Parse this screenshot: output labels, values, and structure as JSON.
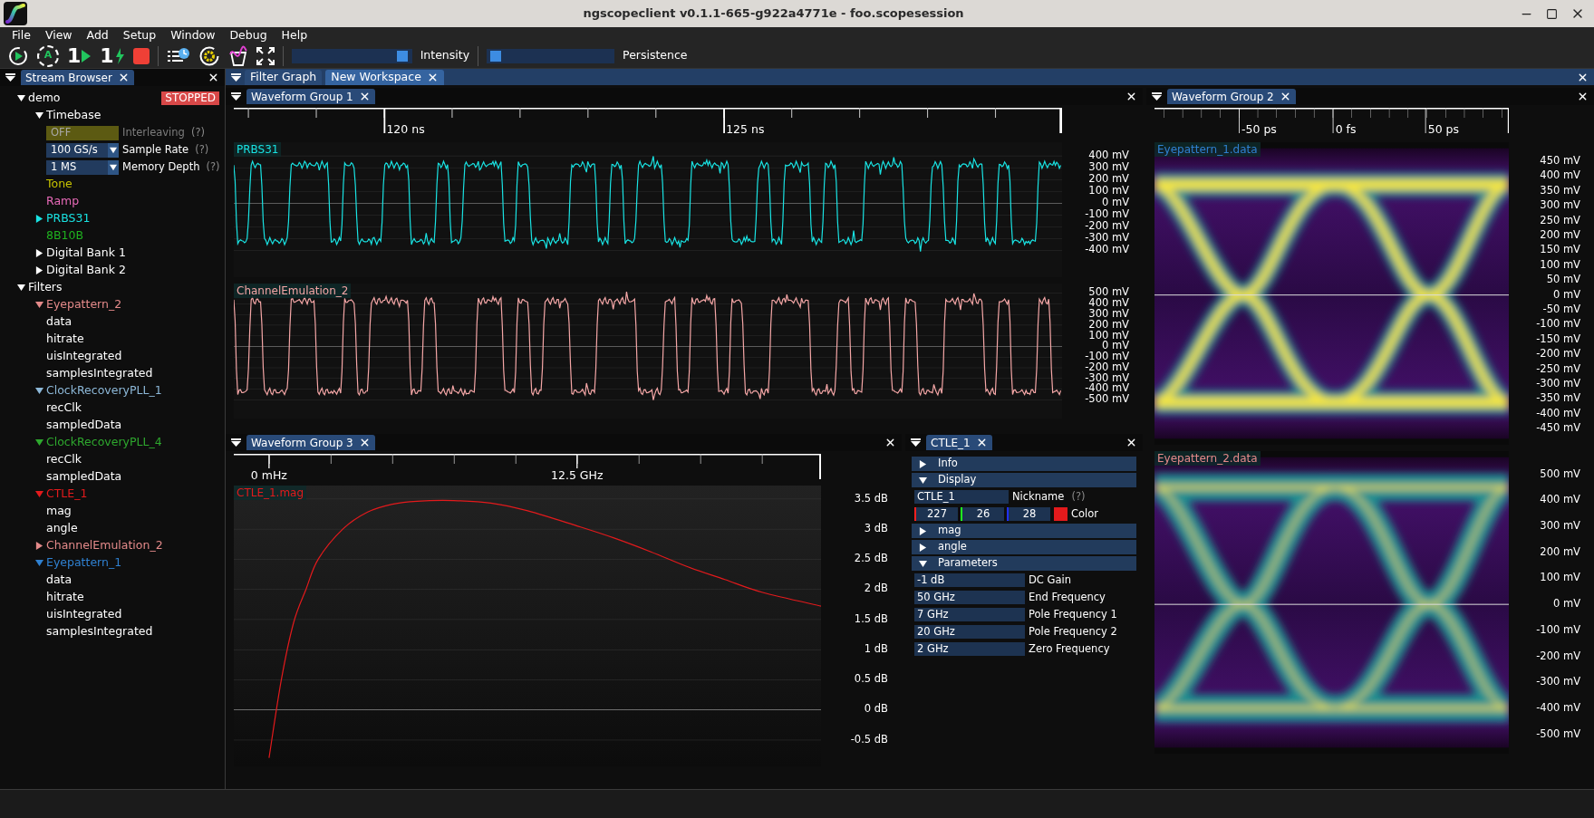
{
  "window": {
    "title": "ngscopeclient v0.1.1-665-g922a4771e  - foo.scopesession"
  },
  "menu": [
    "File",
    "View",
    "Add",
    "Setup",
    "Window",
    "Debug",
    "Help"
  ],
  "toolbar": {
    "buttons": [
      {
        "kind": "start"
      },
      {
        "kind": "auto",
        "glyph": "A"
      },
      {
        "kind": "single",
        "glyph": "1"
      },
      {
        "kind": "force",
        "glyph": "1"
      },
      {
        "kind": "stop"
      },
      {
        "kind": "history"
      },
      {
        "kind": "settings"
      },
      {
        "kind": "filter"
      },
      {
        "kind": "fullscreen"
      }
    ],
    "sliders": [
      {
        "label": "Intensity",
        "level": 0.97
      },
      {
        "label": "Persistence",
        "level": 0.02
      }
    ]
  },
  "stream_browser": {
    "tab": "Stream Browser",
    "tree": [
      {
        "label": "demo",
        "expanded": true,
        "badge": "STOPPED",
        "children": [
          {
            "label": "Timebase",
            "expanded": true,
            "children": [
              {
                "kind": "toggle",
                "value": "OFF",
                "label": "Interleaving",
                "help": "(?)",
                "disabled": true
              },
              {
                "kind": "select",
                "value": "100 GS/s",
                "label": "Sample Rate",
                "help": "(?)",
                "disabled": false
              },
              {
                "kind": "select",
                "value": "1 MS",
                "label": "Memory Depth",
                "help": "(?)",
                "disabled": false
              }
            ]
          },
          {
            "label": "Tone",
            "color": "#c8c400"
          },
          {
            "label": "Ramp",
            "color": "#e86ab8"
          },
          {
            "label": "PRBS31",
            "color": "#19e3e3",
            "expanded": false
          },
          {
            "label": "8B10B",
            "color": "#1fb21f"
          },
          {
            "label": "Digital Bank 1",
            "expanded": false
          },
          {
            "label": "Digital Bank 2",
            "expanded": false
          }
        ]
      },
      {
        "label": "Filters",
        "expanded": true,
        "children": [
          {
            "label": "Eyepattern_2",
            "color": "#e48a8a",
            "expanded": true,
            "children": [
              {
                "label": "data"
              },
              {
                "label": "hitrate"
              },
              {
                "label": "uisIntegrated"
              },
              {
                "label": "samplesIntegrated"
              }
            ]
          },
          {
            "label": "ClockRecoveryPLL_1",
            "color": "#8db8d8",
            "expanded": true,
            "children": [
              {
                "label": "recClk"
              },
              {
                "label": "sampledData"
              }
            ]
          },
          {
            "label": "ClockRecoveryPLL_4",
            "color": "#2ea82e",
            "expanded": true,
            "children": [
              {
                "label": "recClk"
              },
              {
                "label": "sampledData"
              }
            ]
          },
          {
            "label": "CTLE_1",
            "color": "#e31a1c",
            "expanded": true,
            "children": [
              {
                "label": "mag"
              },
              {
                "label": "angle"
              }
            ]
          },
          {
            "label": "ChannelEmulation_2",
            "color": "#e48a8a",
            "expanded": false
          },
          {
            "label": "Eyepattern_1",
            "color": "#2f80d0",
            "expanded": true,
            "children": [
              {
                "label": "data"
              },
              {
                "label": "hitrate"
              },
              {
                "label": "uisIntegrated"
              },
              {
                "label": "samplesIntegrated"
              }
            ]
          }
        ]
      }
    ]
  },
  "workspace_tabs": [
    {
      "label": "Filter Graph",
      "selected": false,
      "closable": false
    },
    {
      "label": "New Workspace",
      "selected": true,
      "closable": true
    }
  ],
  "waveform_groups": [
    {
      "title": "Waveform Group 1",
      "time_labels": [
        "120 ns",
        "125 ns"
      ],
      "plots": [
        {
          "name": "PRBS31",
          "kind": "trace",
          "color": "#19e3e3",
          "y_labels": [
            "400 mV",
            "300 mV",
            "200 mV",
            "100 mV",
            "0 mV",
            "-100 mV",
            "-200 mV",
            "-300 mV",
            "-400 mV"
          ]
        },
        {
          "name": "ChannelEmulation_2",
          "kind": "trace",
          "color": "#f4a6a6",
          "y_labels": [
            "500 mV",
            "400 mV",
            "300 mV",
            "200 mV",
            "100 mV",
            "0 mV",
            "-100 mV",
            "-200 mV",
            "-300 mV",
            "-400 mV",
            "-500 mV"
          ]
        }
      ]
    },
    {
      "title": "Waveform Group 3",
      "plots": [
        {
          "kind": "spectrum",
          "chart_data": {
            "type": "line",
            "x": [
              0,
              0.5,
              1,
              1.5,
              2,
              3,
              4,
              5,
              6,
              7.5,
              9,
              10.5,
              12.5,
              14,
              15.5,
              17,
              18.5,
              20,
              22.4
            ],
            "series": [
              {
                "name": "CTLE_1.mag",
                "color": "#e31a1c",
                "values": [
                  -0.8,
                  0.5,
                  1.45,
                  2.0,
                  2.5,
                  3.0,
                  3.28,
                  3.41,
                  3.46,
                  3.47,
                  3.43,
                  3.3,
                  3.05,
                  2.85,
                  2.62,
                  2.37,
                  2.16,
                  1.95,
                  1.72
                ]
              }
            ],
            "xlim": [
              -1.43,
              22.4
            ],
            "ylim": [
              -0.94,
              3.72
            ],
            "xticks": [
              {
                "value": 0,
                "label": "0 mHz"
              },
              {
                "value": 12.5,
                "label": "12.5 GHz"
              }
            ],
            "yticks": [
              {
                "value": 3.5,
                "label": "3.5 dB"
              },
              {
                "value": 3,
                "label": "3 dB"
              },
              {
                "value": 2.5,
                "label": "2.5 dB"
              },
              {
                "value": 2,
                "label": "2 dB"
              },
              {
                "value": 1.5,
                "label": "1.5 dB"
              },
              {
                "value": 1,
                "label": "1 dB"
              },
              {
                "value": 0.5,
                "label": "0.5 dB"
              },
              {
                "value": 0,
                "label": "0 dB"
              },
              {
                "value": -0.5,
                "label": "-0.5 dB"
              }
            ]
          }
        }
      ]
    },
    {
      "title": "Waveform Group 2",
      "time_labels": [
        "-50 ps",
        "0 fs",
        "50 ps"
      ],
      "plots": [
        {
          "name": "Eyepattern_1.data",
          "kind": "eye",
          "color": "#2f80d0",
          "y_labels": [
            "450 mV",
            "400 mV",
            "350 mV",
            "300 mV",
            "250 mV",
            "200 mV",
            "150 mV",
            "100 mV",
            "50 mV",
            "0 mV",
            "-50 mV",
            "-100 mV",
            "-150 mV",
            "-200 mV",
            "-250 mV",
            "-300 mV",
            "-350 mV",
            "-400 mV",
            "-450 mV"
          ]
        },
        {
          "name": "Eyepattern_2.data",
          "kind": "eye",
          "color": "#e48a8a",
          "y_labels": [
            "500 mV",
            "400 mV",
            "300 mV",
            "200 mV",
            "100 mV",
            "0 mV",
            "-100 mV",
            "-200 mV",
            "-300 mV",
            "-400 mV",
            "-500 mV"
          ]
        }
      ]
    }
  ],
  "filter_panel": {
    "tab": "CTLE_1",
    "sections": [
      {
        "title": "Info",
        "expanded": false
      },
      {
        "title": "Display",
        "expanded": true,
        "nickname": {
          "value": "CTLE_1",
          "label": "Nickname",
          "help": "(?)"
        },
        "color": {
          "r": "227",
          "g": "26",
          "b": "28",
          "label": "Color"
        }
      },
      {
        "title": "mag",
        "expanded": false
      },
      {
        "title": "angle",
        "expanded": false
      },
      {
        "title": "Parameters",
        "expanded": true,
        "params": [
          {
            "value": "-1 dB",
            "label": "DC Gain"
          },
          {
            "value": "50 GHz",
            "label": "End Frequency"
          },
          {
            "value": "7 GHz",
            "label": "Pole Frequency 1"
          },
          {
            "value": "20 GHz",
            "label": "Pole Frequency 2"
          },
          {
            "value": "2 GHz",
            "label": "Zero Frequency"
          }
        ]
      }
    ]
  }
}
